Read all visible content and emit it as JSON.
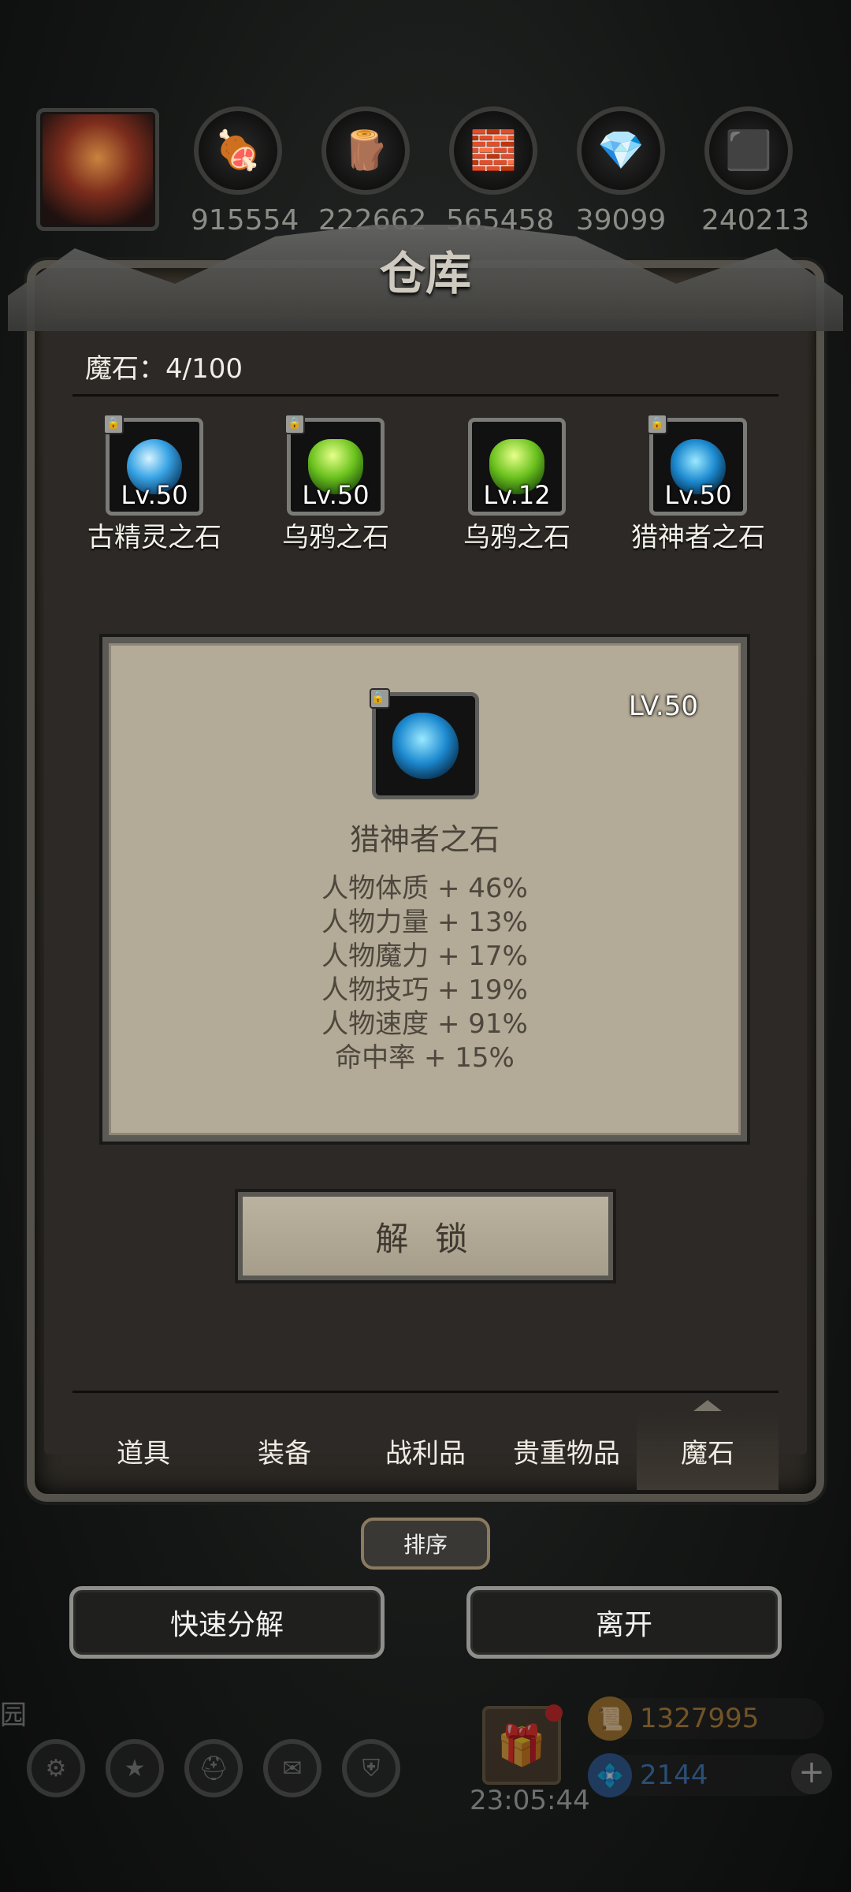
{
  "resources": [
    {
      "icon": "meat-icon",
      "glyph": "🍖",
      "value": "915554"
    },
    {
      "icon": "wood-icon",
      "glyph": "🪵",
      "value": "222662"
    },
    {
      "icon": "stone-icon",
      "glyph": "🧱",
      "value": "565458"
    },
    {
      "icon": "crystal-icon",
      "glyph": "💎",
      "value": "39099"
    },
    {
      "icon": "iron-icon",
      "glyph": "⬛",
      "value": "240213"
    }
  ],
  "panel": {
    "title": "仓库",
    "capacity": "魔石：4/100"
  },
  "stones": [
    {
      "name": "古精灵之石",
      "level": "Lv.50",
      "gem": "blue"
    },
    {
      "name": "乌鸦之石",
      "level": "Lv.50",
      "gem": "green"
    },
    {
      "name": "乌鸦之石",
      "level": "Lv.12",
      "gem": "green"
    },
    {
      "name": "猎神者之石",
      "level": "Lv.50",
      "gem": "cyan"
    }
  ],
  "detail": {
    "level": "LV.50",
    "name": "猎神者之石",
    "stats": [
      "人物体质 + 46%",
      "人物力量 + 13%",
      "人物魔力 + 17%",
      "人物技巧 + 19%",
      "人物速度 + 91%",
      "命中率 + 15%"
    ]
  },
  "unlock_label": "解 锁",
  "tabs": [
    "道具",
    "装备",
    "战利品",
    "贵重物品",
    "魔石"
  ],
  "active_tab": 4,
  "sort_label": "排序",
  "quick_decompose_label": "快速分解",
  "leave_label": "离开",
  "hud": {
    "timer": "23:05:44",
    "gold": "1327995",
    "gems": "2144",
    "side_text": "园"
  },
  "colors": {
    "gold_text": "#c28a3a",
    "gem_text": "#3f7fc8"
  }
}
